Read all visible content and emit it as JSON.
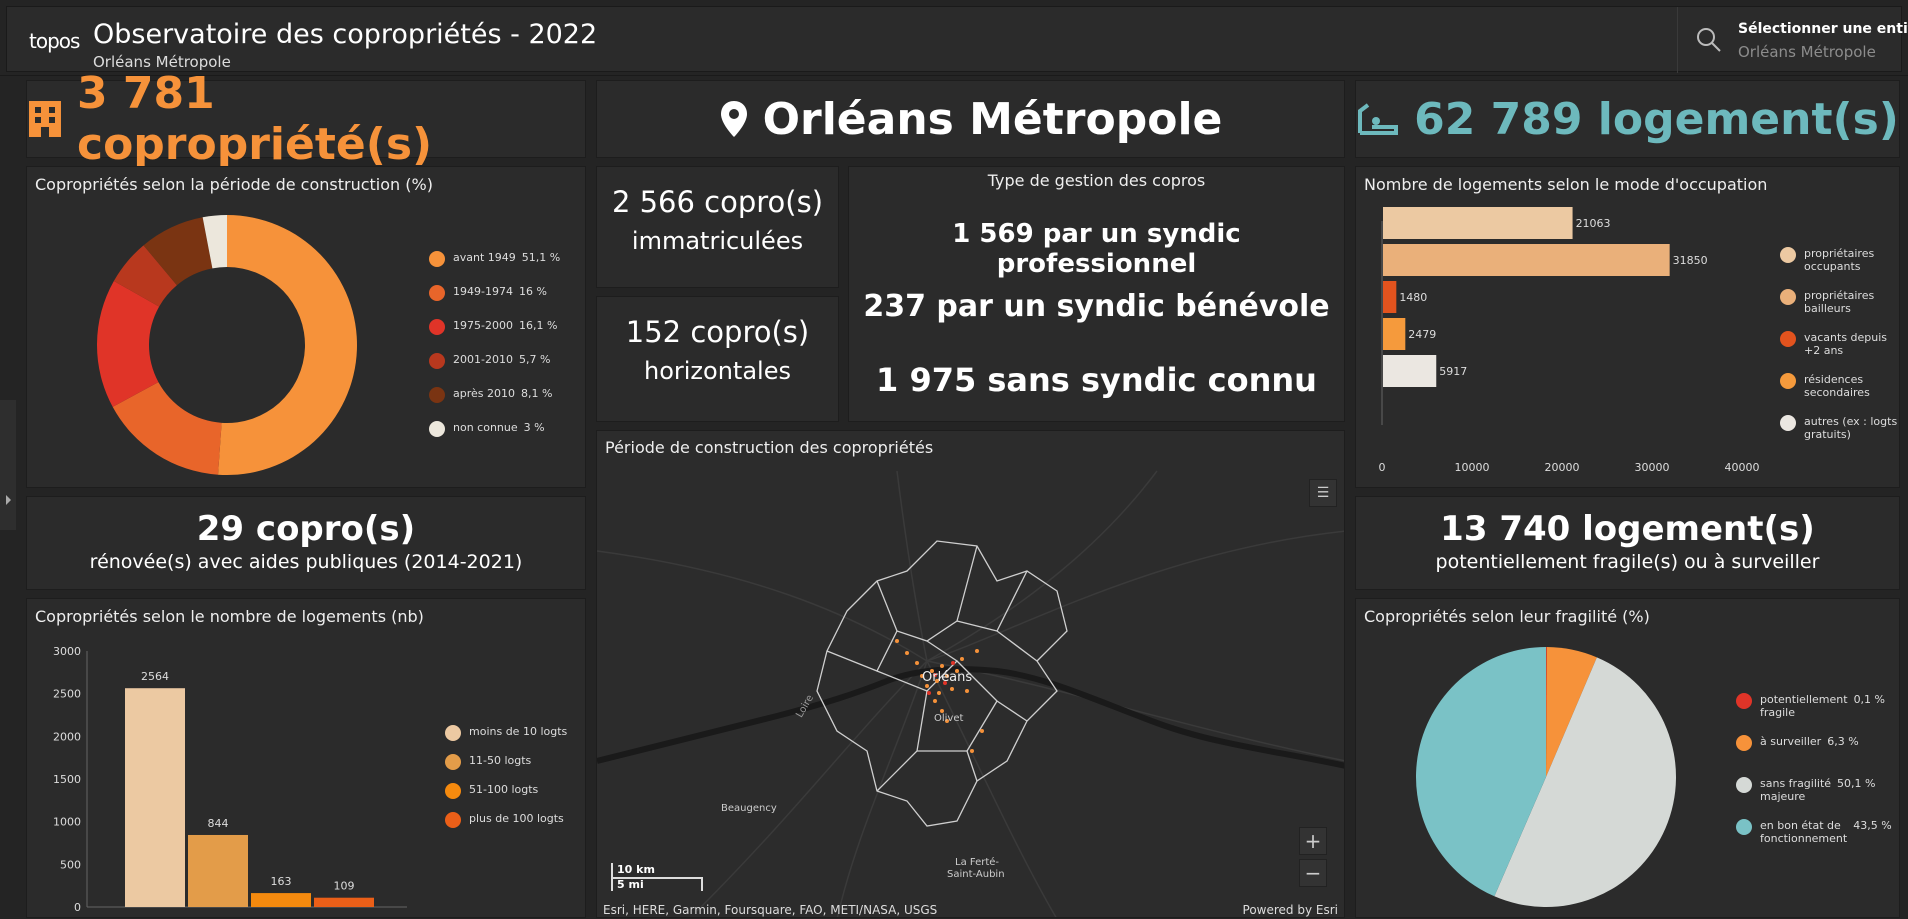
{
  "header": {
    "logo": "topos",
    "title": "Observatoire des copropriétés - 2022",
    "subtitle": "Orléans Métropole",
    "entity_label": "Sélectionner une entité :",
    "entity_value": "Orléans Métropole"
  },
  "kpi": {
    "coproprietes": "3 781 copropriété(s)",
    "territory": "Orléans Métropole",
    "logements": "62 789 logement(s)",
    "immatriculees_count": "2 566 copro(s)",
    "immatriculees_label": "immatriculées",
    "horizontales_count": "152 copro(s)",
    "horizontales_label": "horizontales",
    "renovees_count": "29 copro(s)",
    "renovees_label": "rénovée(s) avec aides publiques (2014-2021)",
    "fragiles_count": "13 740 logement(s)",
    "fragiles_label": "potentiellement fragile(s) ou à surveiller"
  },
  "gestion": {
    "title": "Type de gestion des copros",
    "line1": "1 569 par un syndic professionnel",
    "line2": "237 par un syndic bénévole",
    "line3": "1 975 sans syndic connu"
  },
  "colors": {
    "orange": "#f6923a",
    "teal": "#6db9bd",
    "panel": "#2b2b2b"
  },
  "chart_data": [
    {
      "id": "periode",
      "type": "pie",
      "title": "Copropriétés selon la période de construction (%)",
      "categories": [
        "avant 1949",
        "1949-1974",
        "1975-2000",
        "2001-2010",
        "après 2010",
        "non connue"
      ],
      "values": [
        51.1,
        16,
        16.1,
        5.7,
        8.1,
        3
      ],
      "labels": [
        "51,1 %",
        "16 %",
        "16,1 %",
        "5,7 %",
        "8,1 %",
        "3 %"
      ],
      "colors": [
        "#f6923a",
        "#e8652a",
        "#e03428",
        "#b8381e",
        "#7a3412",
        "#ece7dc"
      ],
      "legend": "right",
      "donut": true
    },
    {
      "id": "occupation",
      "type": "bar",
      "orientation": "horizontal",
      "title": "Nombre de logements selon le mode d'occupation",
      "categories": [
        "propriétaires occupants",
        "propriétaires bailleurs",
        "vacants depuis +2 ans",
        "résidences secondaires",
        "autres (ex : logts gratuits)"
      ],
      "legend_lines": [
        [
          "propriétaires",
          "occupants"
        ],
        [
          "propriétaires",
          "bailleurs"
        ],
        [
          "vacants depuis",
          "+2 ans"
        ],
        [
          "résidences",
          "secondaires"
        ],
        [
          "autres (ex : logts",
          "gratuits)"
        ]
      ],
      "values": [
        21063,
        31850,
        1480,
        2479,
        5917
      ],
      "value_labels": [
        "21063",
        "31850",
        "1480",
        "2479",
        "5917"
      ],
      "colors": [
        "#ecc9a2",
        "#eab07a",
        "#e2531e",
        "#f59a3c",
        "#ebe7e1"
      ],
      "xlim": [
        0,
        40000
      ],
      "xticks": [
        "0",
        "10000",
        "20000",
        "30000",
        "40000"
      ],
      "legend": "right"
    },
    {
      "id": "nb-logements",
      "type": "bar",
      "title": "Copropriétés selon le nombre de logements (nb)",
      "categories": [
        "moins de 10 logts",
        "11-50 logts",
        "51-100 logts",
        "plus de 100 logts"
      ],
      "values": [
        2564,
        844,
        163,
        109
      ],
      "value_labels": [
        "2564",
        "844",
        "163",
        "109"
      ],
      "colors": [
        "#ecc9a2",
        "#e39c49",
        "#f58a0e",
        "#eb5f18"
      ],
      "ylim": [
        0,
        3000
      ],
      "yticks": [
        "0",
        "500",
        "1000",
        "1500",
        "2000",
        "2500",
        "3000"
      ],
      "legend": "right"
    },
    {
      "id": "fragilite",
      "type": "pie",
      "title": "Copropriétés selon leur fragilité (%)",
      "categories": [
        "potentiellement fragile",
        "à surveiller",
        "sans fragilité majeure",
        "en bon état de fonctionnement"
      ],
      "legend_lines": [
        [
          "potentiellement",
          "fragile"
        ],
        [
          "à surveiller"
        ],
        [
          "sans fragilité",
          "majeure"
        ],
        [
          "en bon état de",
          "fonctionnement"
        ]
      ],
      "values": [
        0.1,
        6.3,
        50.1,
        43.5
      ],
      "labels": [
        "0,1 %",
        "6,3 %",
        "50,1 %",
        "43,5 %"
      ],
      "colors": [
        "#e03428",
        "#f6923a",
        "#d5d9d6",
        "#7ac2c6"
      ],
      "legend": "right"
    }
  ],
  "map": {
    "title": "Période de construction des copropriétés",
    "places": [
      "Orléans",
      "Olivet",
      "Beaugency",
      "La Ferté-",
      "Saint-Aubin",
      "Loire"
    ],
    "scale_km": "10 km",
    "scale_mi": "5 mi",
    "attribution": "Esri, HERE, Garmin, Foursquare, FAO, METI/NASA, USGS",
    "powered": "Powered by Esri",
    "zoom_in": "+",
    "zoom_out": "−"
  }
}
